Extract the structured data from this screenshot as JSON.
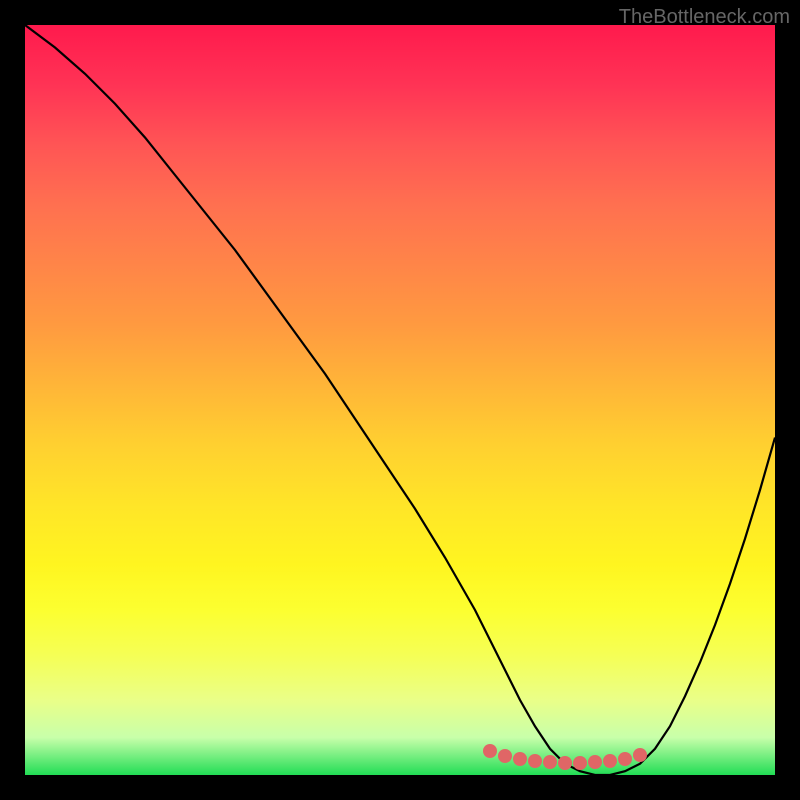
{
  "watermark": "TheBottleneck.com",
  "chart_data": {
    "type": "line",
    "title": "",
    "xlabel": "",
    "ylabel": "",
    "xlim": [
      0,
      100
    ],
    "ylim": [
      0,
      100
    ],
    "series": [
      {
        "name": "curve",
        "x": [
          0,
          4,
          8,
          12,
          16,
          20,
          24,
          28,
          32,
          36,
          40,
          44,
          48,
          52,
          56,
          60,
          62,
          64,
          66,
          68,
          70,
          72,
          74,
          76,
          78,
          80,
          82,
          84,
          86,
          88,
          90,
          92,
          94,
          96,
          98,
          100
        ],
        "values": [
          100,
          97,
          93.5,
          89.5,
          85,
          80,
          75,
          70,
          64.5,
          59,
          53.5,
          47.5,
          41.5,
          35.5,
          29,
          22,
          18,
          14,
          10,
          6.5,
          3.5,
          1.5,
          0.5,
          0,
          0,
          0.5,
          1.5,
          3.5,
          6.5,
          10.5,
          15,
          20,
          25.5,
          31.5,
          38,
          45
        ]
      }
    ],
    "markers": {
      "name": "optimal-range",
      "x": [
        62,
        64,
        66,
        68,
        70,
        72,
        74,
        76,
        78,
        80,
        82
      ],
      "y": [
        3.2,
        2.6,
        2.2,
        1.9,
        1.7,
        1.6,
        1.6,
        1.7,
        1.9,
        2.2,
        2.7
      ]
    },
    "gradient_stops": [
      {
        "pos": 0,
        "color": "#ff1a4d"
      },
      {
        "pos": 50,
        "color": "#ffc030"
      },
      {
        "pos": 90,
        "color": "#f0ff70"
      },
      {
        "pos": 100,
        "color": "#22dd55"
      }
    ]
  }
}
